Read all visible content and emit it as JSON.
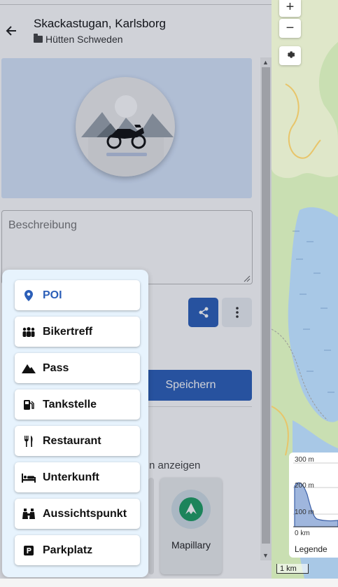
{
  "header": {
    "title": "Skackastugan, Karlsborg",
    "folder": "Hütten Schweden"
  },
  "description": {
    "placeholder": "Beschreibung"
  },
  "actions": {
    "save_label": "Speichern"
  },
  "sources": {
    "show_text": "n anzeigen",
    "mapillary_label": "Mapillary"
  },
  "map": {
    "zoom_in": "+",
    "zoom_out": "−",
    "scale": "1 km",
    "elevation": {
      "ticks": [
        "300 m",
        "200 m",
        "100 m",
        "0 km"
      ],
      "legend": "Legende"
    }
  },
  "menu": {
    "items": [
      {
        "label": "POI",
        "icon": "map-pin-icon",
        "active": true
      },
      {
        "label": "Bikertreff",
        "icon": "group-icon",
        "active": false
      },
      {
        "label": "Pass",
        "icon": "mountain-icon",
        "active": false
      },
      {
        "label": "Tankstelle",
        "icon": "gas-pump-icon",
        "active": false
      },
      {
        "label": "Restaurant",
        "icon": "utensils-icon",
        "active": false
      },
      {
        "label": "Unterkunft",
        "icon": "bed-icon",
        "active": false
      },
      {
        "label": "Aussichtspunkt",
        "icon": "binoculars-icon",
        "active": false
      },
      {
        "label": "Parkplatz",
        "icon": "parking-icon",
        "active": false
      }
    ]
  },
  "colors": {
    "accent": "#2c5fb8",
    "menu_bg": "#e7f3fd",
    "hero_bg": "#d7e6fb"
  }
}
